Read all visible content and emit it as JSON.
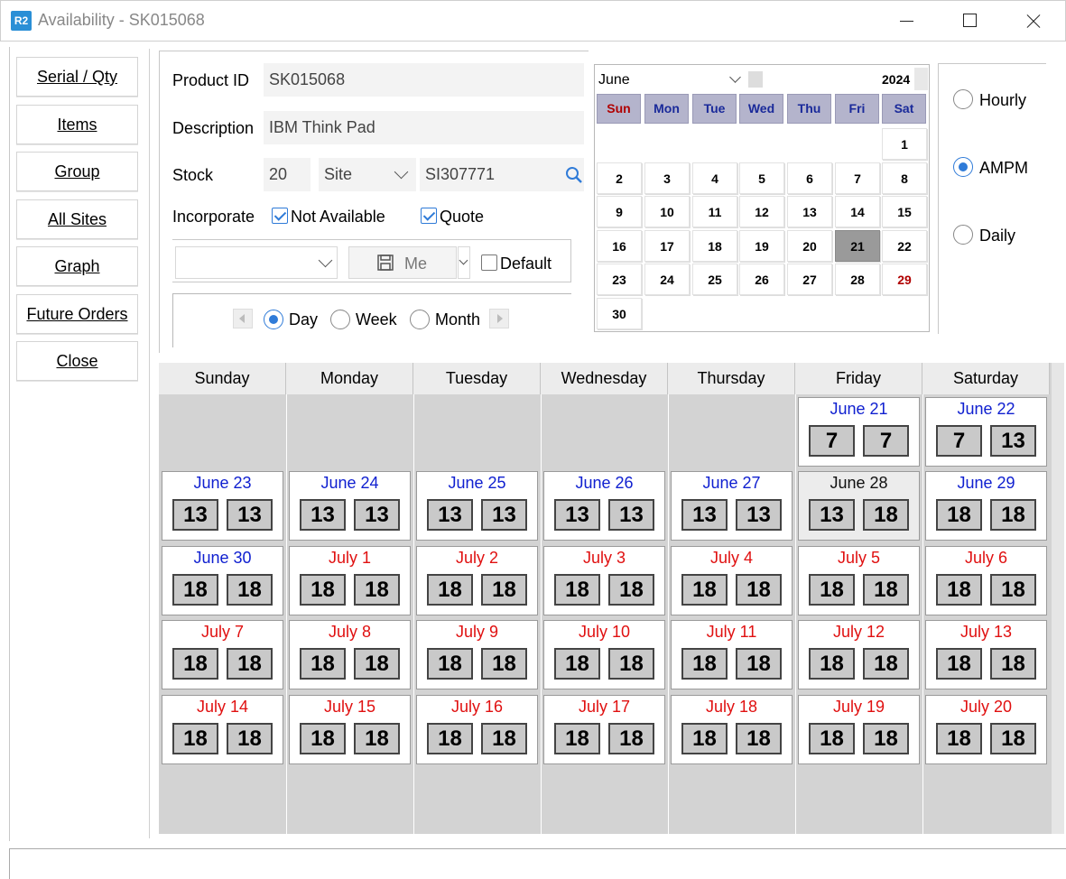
{
  "window": {
    "logo": "R2",
    "title": "Availability - SK015068"
  },
  "nav": [
    "Serial / Qty",
    "Items",
    "Group",
    "All Sites",
    "Graph",
    "Future Orders",
    "Close"
  ],
  "product": {
    "id_label": "Product ID",
    "id_value": "SK015068",
    "desc_label": "Description",
    "desc_value": "IBM Think Pad",
    "stock_label": "Stock",
    "stock_value": "20",
    "site_select": "Site",
    "site_value": "SI307771",
    "incorporate_label": "Incorporate",
    "not_available": "Not Available",
    "quote": "Quote",
    "save_label": "Me",
    "default_label": "Default"
  },
  "view": {
    "day": "Day",
    "week": "Week",
    "month": "Month",
    "selected": "Day"
  },
  "mode": {
    "hourly": "Hourly",
    "ampm": "AMPM",
    "daily": "Daily",
    "selected": "AMPM"
  },
  "mini_calendar": {
    "month": "June",
    "year": "2024",
    "weekdays": [
      "Sun",
      "Mon",
      "Tue",
      "Wed",
      "Thu",
      "Fri",
      "Sat"
    ],
    "rows": [
      [
        "",
        "",
        "",
        "",
        "",
        "",
        "1"
      ],
      [
        "2",
        "3",
        "4",
        "5",
        "6",
        "7",
        "8"
      ],
      [
        "9",
        "10",
        "11",
        "12",
        "13",
        "14",
        "15"
      ],
      [
        "16",
        "17",
        "18",
        "19",
        "20",
        "21",
        "22"
      ],
      [
        "23",
        "24",
        "25",
        "26",
        "27",
        "28",
        "29"
      ],
      [
        "30",
        "",
        "",
        "",
        "",
        "",
        ""
      ]
    ],
    "selected_day": "21",
    "highlight_day": "29"
  },
  "calendar": {
    "weekdays": [
      "Sunday",
      "Monday",
      "Tuesday",
      "Wednesday",
      "Thursday",
      "Friday",
      "Saturday"
    ],
    "weeks": [
      [
        null,
        null,
        null,
        null,
        null,
        {
          "date": "June 21",
          "color": "blue",
          "am": "7",
          "pm": "7"
        },
        {
          "date": "June 22",
          "color": "blue",
          "am": "7",
          "pm": "13"
        }
      ],
      [
        {
          "date": "June 23",
          "color": "blue",
          "am": "13",
          "pm": "13"
        },
        {
          "date": "June 24",
          "color": "blue",
          "am": "13",
          "pm": "13"
        },
        {
          "date": "June 25",
          "color": "blue",
          "am": "13",
          "pm": "13"
        },
        {
          "date": "June 26",
          "color": "blue",
          "am": "13",
          "pm": "13"
        },
        {
          "date": "June 27",
          "color": "blue",
          "am": "13",
          "pm": "13"
        },
        {
          "date": "June 28",
          "color": "black",
          "am": "13",
          "pm": "18",
          "highlight": true
        },
        {
          "date": "June 29",
          "color": "blue",
          "am": "18",
          "pm": "18"
        }
      ],
      [
        {
          "date": "June 30",
          "color": "blue",
          "am": "18",
          "pm": "18"
        },
        {
          "date": "July 1",
          "color": "red",
          "am": "18",
          "pm": "18"
        },
        {
          "date": "July 2",
          "color": "red",
          "am": "18",
          "pm": "18"
        },
        {
          "date": "July 3",
          "color": "red",
          "am": "18",
          "pm": "18"
        },
        {
          "date": "July 4",
          "color": "red",
          "am": "18",
          "pm": "18"
        },
        {
          "date": "July 5",
          "color": "red",
          "am": "18",
          "pm": "18"
        },
        {
          "date": "July 6",
          "color": "red",
          "am": "18",
          "pm": "18"
        }
      ],
      [
        {
          "date": "July 7",
          "color": "red",
          "am": "18",
          "pm": "18"
        },
        {
          "date": "July 8",
          "color": "red",
          "am": "18",
          "pm": "18"
        },
        {
          "date": "July 9",
          "color": "red",
          "am": "18",
          "pm": "18"
        },
        {
          "date": "July 10",
          "color": "red",
          "am": "18",
          "pm": "18"
        },
        {
          "date": "July 11",
          "color": "red",
          "am": "18",
          "pm": "18"
        },
        {
          "date": "July 12",
          "color": "red",
          "am": "18",
          "pm": "18"
        },
        {
          "date": "July 13",
          "color": "red",
          "am": "18",
          "pm": "18"
        }
      ],
      [
        {
          "date": "July 14",
          "color": "red",
          "am": "18",
          "pm": "18"
        },
        {
          "date": "July 15",
          "color": "red",
          "am": "18",
          "pm": "18"
        },
        {
          "date": "July 16",
          "color": "red",
          "am": "18",
          "pm": "18"
        },
        {
          "date": "July 17",
          "color": "red",
          "am": "18",
          "pm": "18"
        },
        {
          "date": "July 18",
          "color": "red",
          "am": "18",
          "pm": "18"
        },
        {
          "date": "July 19",
          "color": "red",
          "am": "18",
          "pm": "18"
        },
        {
          "date": "July 20",
          "color": "red",
          "am": "18",
          "pm": "18"
        }
      ]
    ]
  }
}
